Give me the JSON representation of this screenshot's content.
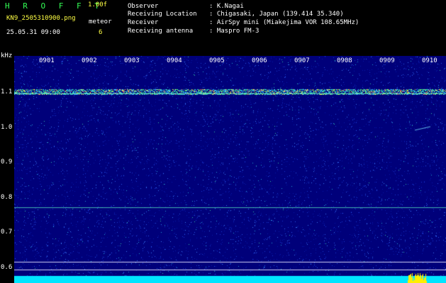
{
  "header": {
    "brand": "H R O F F T",
    "version": "1.00f",
    "filename": "KN9_2505310900.png",
    "mode": "meteor",
    "datetime": "25.05.31 09:00",
    "count": "6",
    "info": [
      {
        "label": "Observer",
        "value": ": K.Nagai"
      },
      {
        "label": "Receiving Location",
        "value": ": Chigasaki, Japan (139.414 35.340)"
      },
      {
        "label": "Receiver",
        "value": ": AirSpy mini (Miakejima VOR 108.65MHz)"
      },
      {
        "label": "Receiving antenna",
        "value": ": Maspro FM-3"
      }
    ]
  },
  "spectrogram": {
    "unit": "kHz",
    "y_ticks": [
      "1.1",
      "1.0",
      "0.9",
      "0.8",
      "0.7",
      "0.6"
    ],
    "time_ticks": [
      "0901",
      "0902",
      "0903",
      "0904",
      "0905",
      "0906",
      "0907",
      "0908",
      "0909",
      "0910"
    ],
    "colors": {
      "background": "#00007a",
      "signal": "#33dd88",
      "peak": "#ffee00",
      "base": "#00e5ff"
    }
  }
}
